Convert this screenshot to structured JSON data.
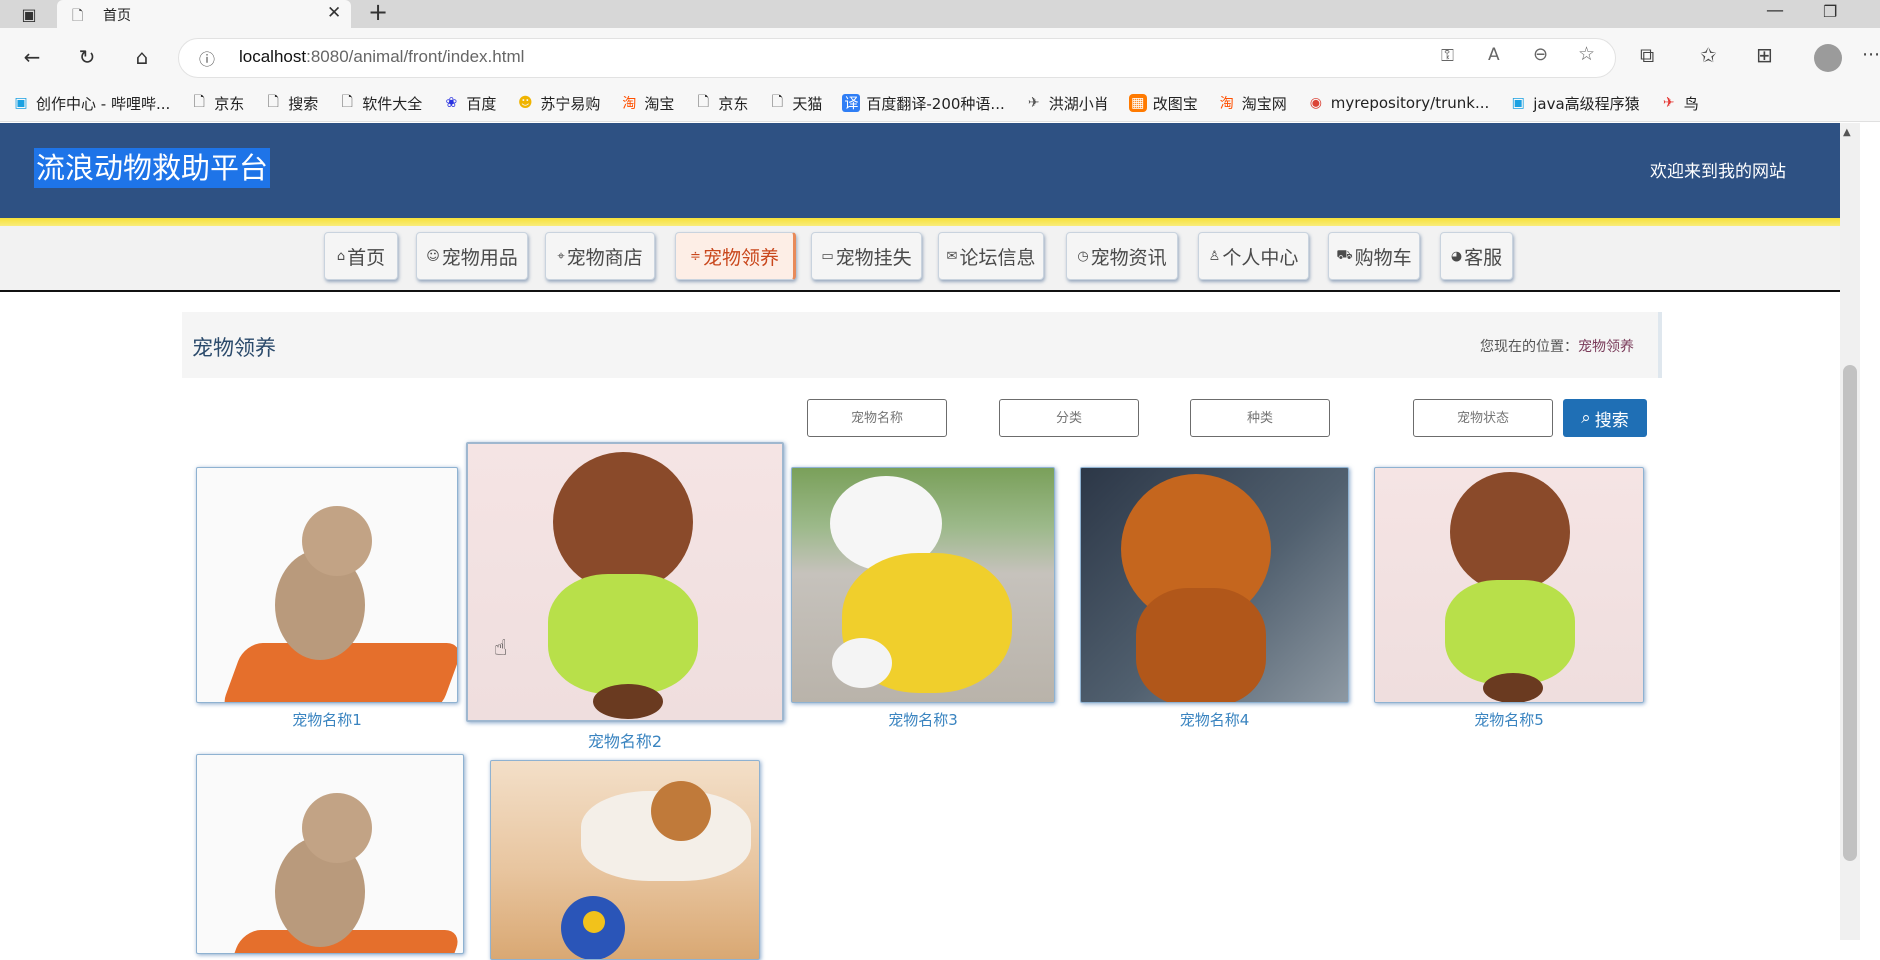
{
  "browser": {
    "tab_title": "首页",
    "url_host": "localhost",
    "url_rest": ":8080/animal/front/index.html",
    "favorites": [
      {
        "label": "创作中心 - 哔哩哔...",
        "icon": "bilibili-icon"
      },
      {
        "label": "京东",
        "icon": "page-icon"
      },
      {
        "label": "搜索",
        "icon": "page-icon"
      },
      {
        "label": "软件大全",
        "icon": "page-icon"
      },
      {
        "label": "百度",
        "icon": "baidu-icon"
      },
      {
        "label": "苏宁易购",
        "icon": "suning-icon"
      },
      {
        "label": "淘宝",
        "icon": "taobao-icon"
      },
      {
        "label": "京东",
        "icon": "page-icon"
      },
      {
        "label": "天猫",
        "icon": "page-icon"
      },
      {
        "label": "百度翻译-200种语...",
        "icon": "translate-icon"
      },
      {
        "label": "洪湖小肖",
        "icon": "bird-icon"
      },
      {
        "label": "改图宝",
        "icon": "gaitubao-icon"
      },
      {
        "label": "淘宝网",
        "icon": "taobao-icon"
      },
      {
        "label": "myrepository/trunk...",
        "icon": "chrome-icon"
      },
      {
        "label": "java高级程序猿",
        "icon": "bilibili-icon"
      },
      {
        "label": "鸟",
        "icon": "bird-icon"
      }
    ]
  },
  "site": {
    "title": "流浪动物救助平台",
    "welcome": "欢迎来到我的网站"
  },
  "nav": [
    {
      "label": "首页",
      "icon": "⌂"
    },
    {
      "label": "宠物用品",
      "icon": "☺"
    },
    {
      "label": "宠物商店",
      "icon": "⌖"
    },
    {
      "label": "宠物领养",
      "icon": "≑"
    },
    {
      "label": "宠物挂失",
      "icon": "▭"
    },
    {
      "label": "论坛信息",
      "icon": "✉"
    },
    {
      "label": "宠物资讯",
      "icon": "◷"
    },
    {
      "label": "个人中心",
      "icon": "♙"
    },
    {
      "label": "购物车",
      "icon": "⛟"
    },
    {
      "label": "客服",
      "icon": "◕"
    }
  ],
  "breadcrumb": {
    "title": "宠物领养",
    "location_prefix": "您现在的位置：",
    "location": "宠物领养"
  },
  "filters": {
    "name_placeholder": "宠物名称",
    "category_placeholder": "分类",
    "species_placeholder": "种类",
    "status_placeholder": "宠物状态",
    "search_label": "搜索"
  },
  "pets": [
    {
      "name": "宠物名称1"
    },
    {
      "name": "宠物名称2"
    },
    {
      "name": "宠物名称3"
    },
    {
      "name": "宠物名称4"
    },
    {
      "name": "宠物名称5"
    },
    {
      "name": ""
    },
    {
      "name": ""
    }
  ]
}
